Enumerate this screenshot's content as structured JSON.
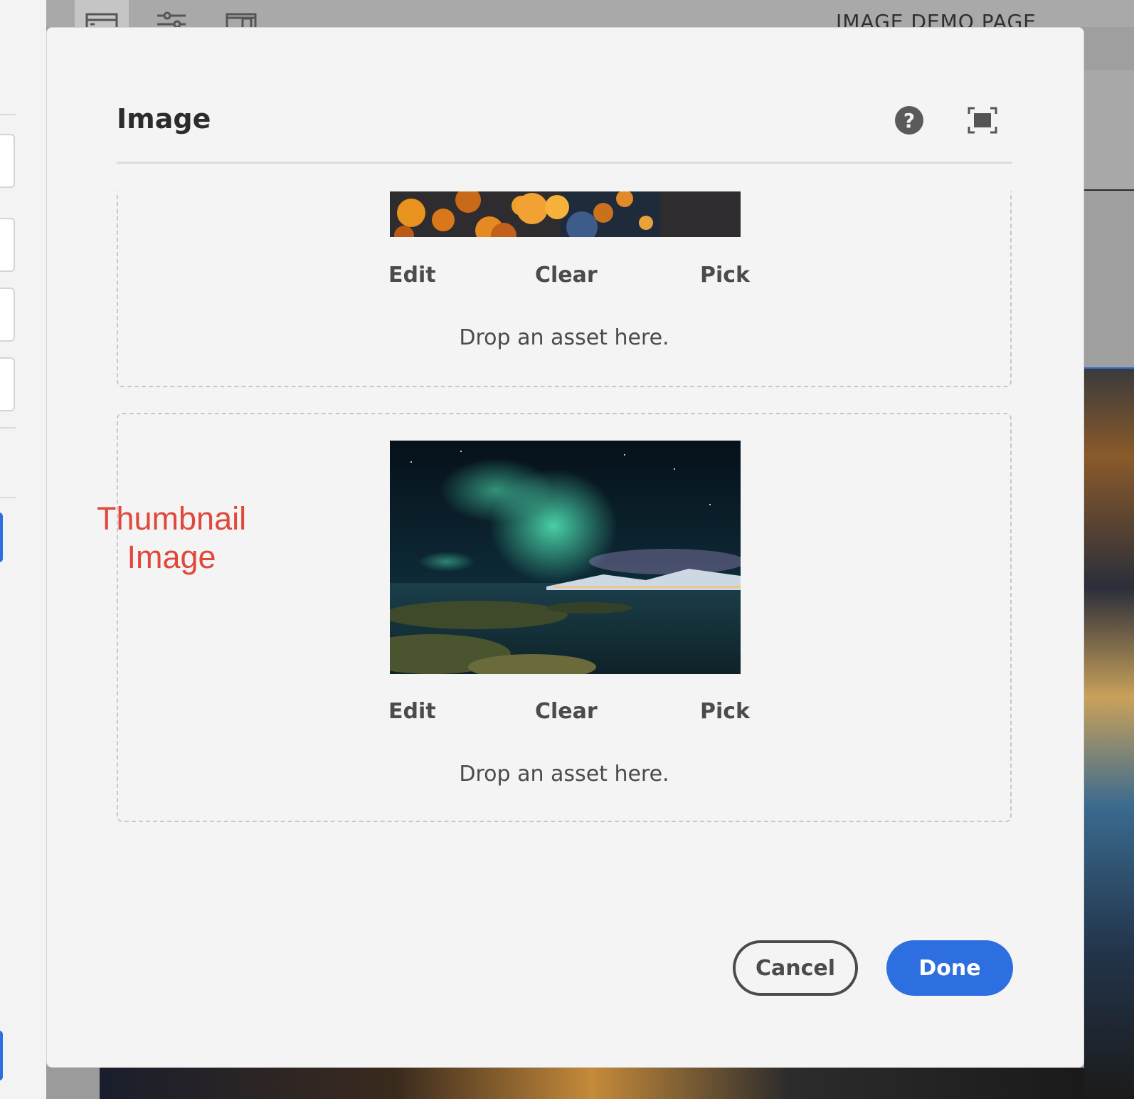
{
  "top_bar": {
    "page_title": "IMAGE DEMO PAGE",
    "toolbar": [
      {
        "icon": "side-panel-icon"
      },
      {
        "icon": "properties-sliders-icon"
      },
      {
        "icon": "emulator-icon"
      }
    ]
  },
  "dialog": {
    "title": "Image",
    "help_icon": "help-icon",
    "help_glyph": "?",
    "fullscreen_icon": "fullscreen-icon",
    "image_fields": [
      {
        "preview": "bokeh-lights-image",
        "actions": {
          "edit": "Edit",
          "clear": "Clear",
          "pick": "Pick"
        },
        "drop_hint": "Drop an asset here."
      },
      {
        "preview": "aurora-borealis-image",
        "actions": {
          "edit": "Edit",
          "clear": "Clear",
          "pick": "Pick"
        },
        "drop_hint": "Drop an asset here."
      }
    ],
    "annotation": {
      "line1": "Thumbnail",
      "line2": "Image",
      "color": "#e0483b"
    },
    "footer": {
      "cancel": "Cancel",
      "done": "Done"
    }
  },
  "colors": {
    "accent": "#2d6fe0",
    "dialog_bg": "#f4f4f4",
    "text": "#4b4b4b"
  }
}
